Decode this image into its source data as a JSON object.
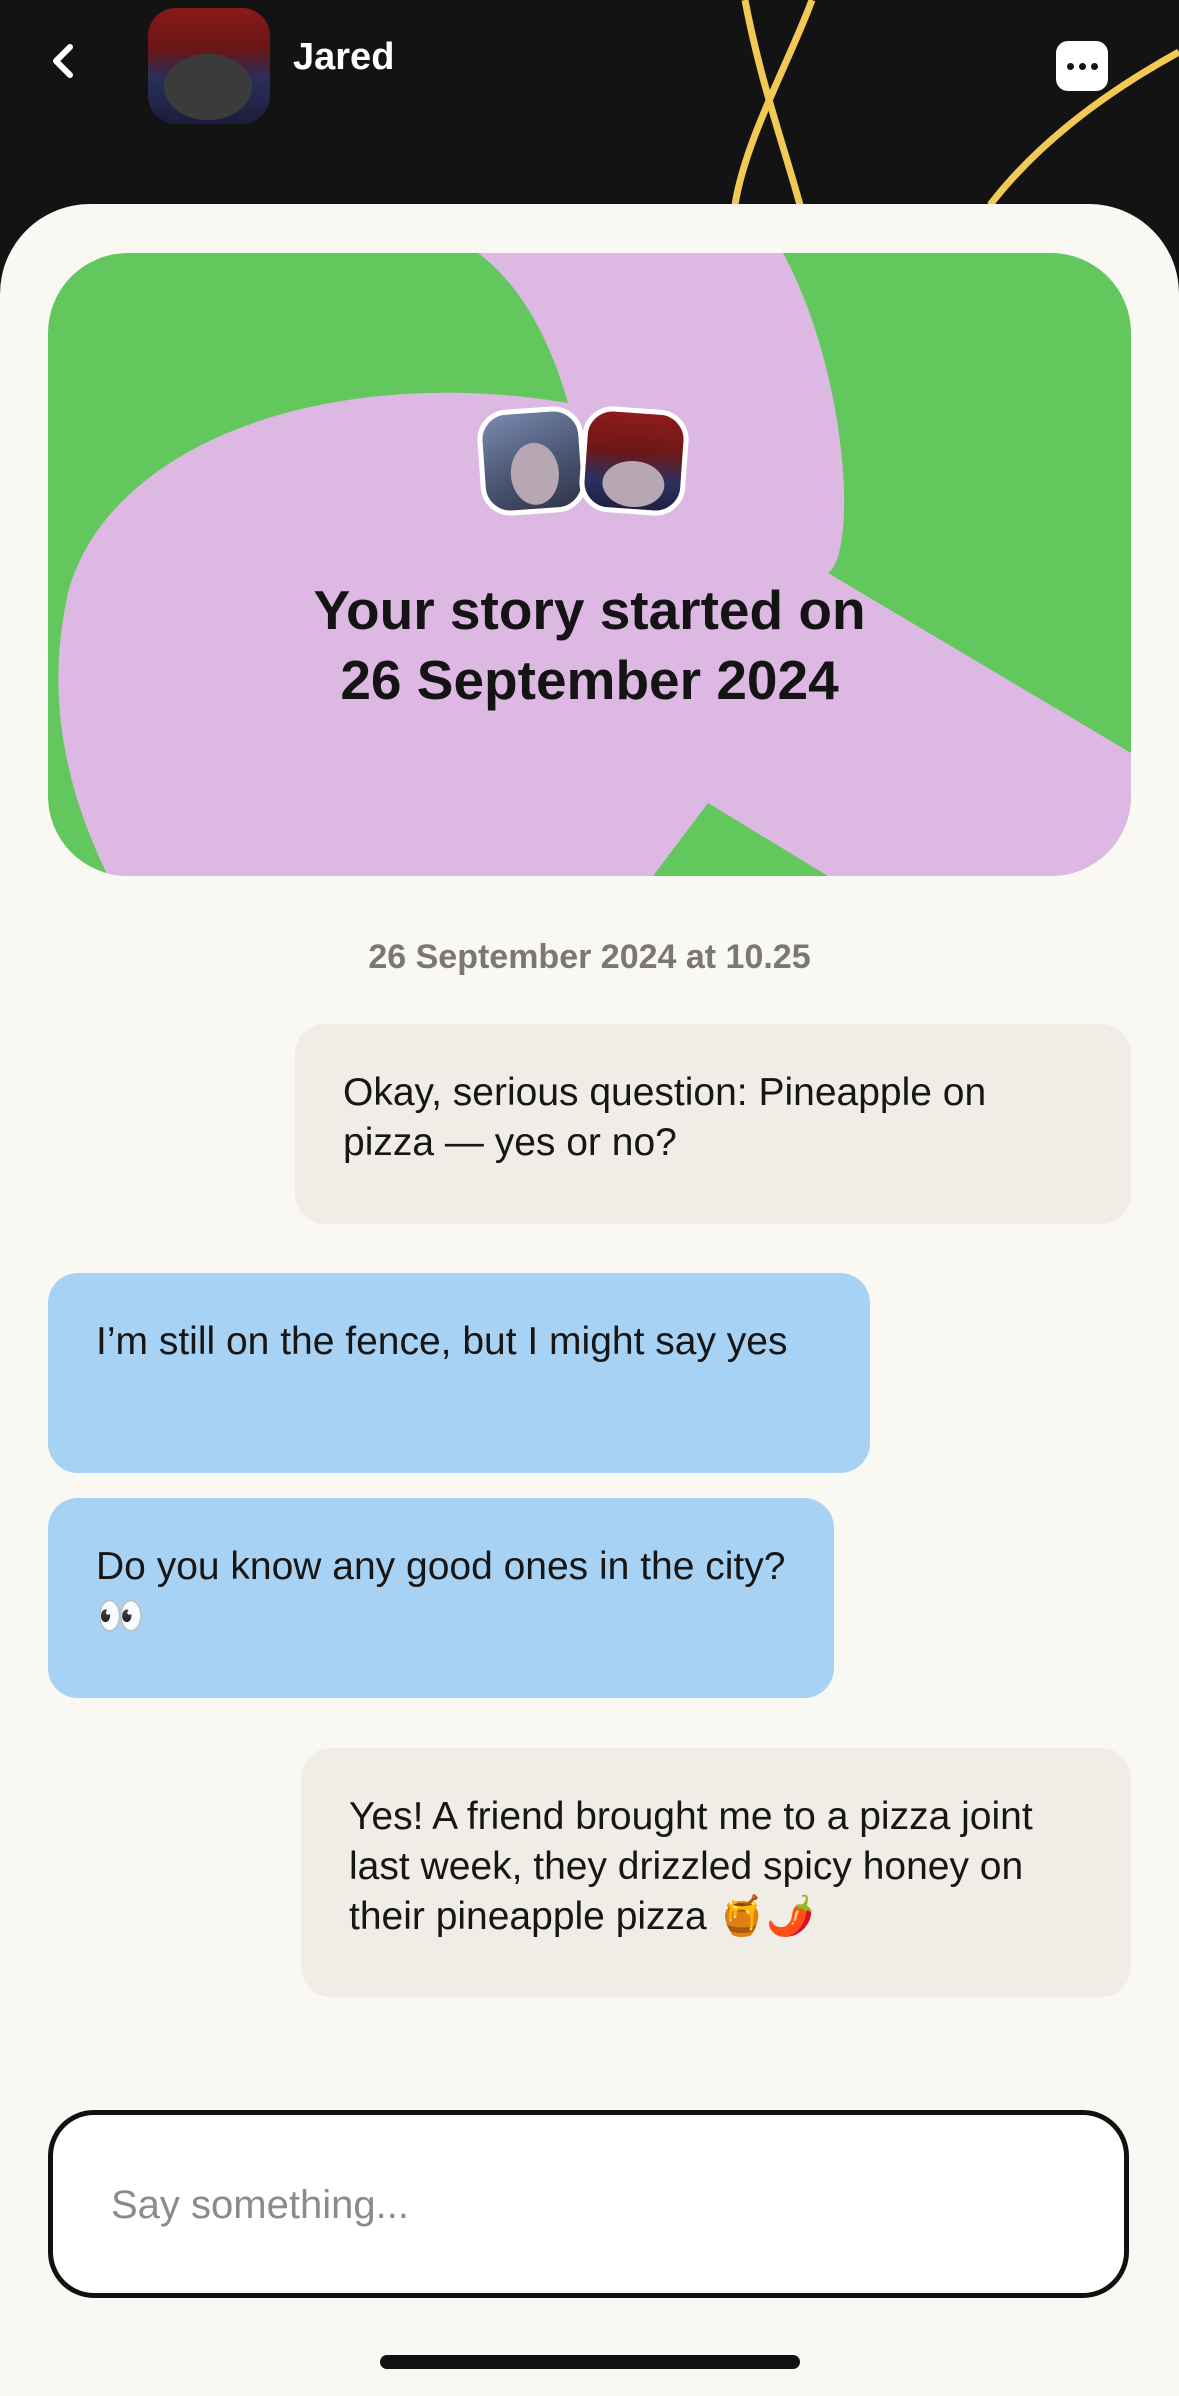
{
  "header": {
    "contact_name": "Jared",
    "back_icon": "chevron-left-icon",
    "menu_icon": "more-horizontal-icon"
  },
  "story_card": {
    "line1": "Your story started on",
    "line2": "26 September 2024"
  },
  "chat": {
    "timestamp": "26 September 2024 at 10.25",
    "messages": [
      {
        "direction": "outgoing",
        "text": "Okay, serious question: Pineapple on pizza — yes or no?"
      },
      {
        "direction": "incoming",
        "text": "I’m still on the fence, but I might say yes"
      },
      {
        "direction": "incoming",
        "text": "Do you know any good ones in the city? 👀"
      },
      {
        "direction": "outgoing",
        "text": "Yes! A friend brought me to a pizza joint last week, they drizzled spicy honey on their pineapple pizza 🍯🌶️"
      }
    ]
  },
  "composer": {
    "placeholder": "Say something..."
  },
  "colors": {
    "header_bg": "#131313",
    "sheet_bg": "#faf8f2",
    "card_green": "#62c85e",
    "card_lilac": "#dcb8e3",
    "incoming_bubble": "#a8d2f3",
    "outgoing_bubble": "#f0ece6",
    "deco_line": "#f2c955"
  }
}
